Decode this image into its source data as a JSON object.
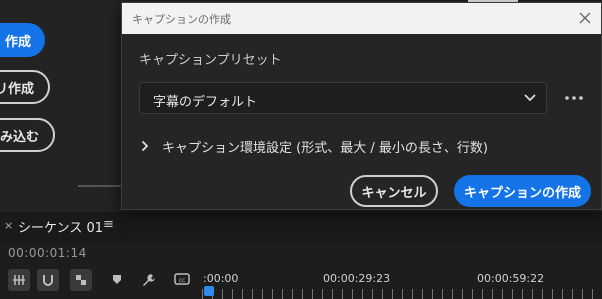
{
  "background": {
    "buttons": [
      {
        "label": "作成"
      },
      {
        "label": "リ作成"
      },
      {
        "label": "み込む"
      }
    ],
    "sequence": {
      "close_icon": "close-icon",
      "tab_title": "シーケンス 01",
      "menu_glyph": "≡",
      "timecode": "00:00:01:14"
    },
    "ruler": {
      "labels": [
        ":00:00",
        "00:00:29:23",
        "00:00:59:22"
      ]
    },
    "colors": {
      "accent": "#1473e6",
      "playhead": "#2d8ceb"
    }
  },
  "dialog": {
    "title": "キャプションの作成",
    "preset_section_label": "キャプションプリセット",
    "preset_selected": "字幕のデフォルト",
    "settings_disclosure": "キャプション環境設定 (形式、最大 / 最小の長さ、行数)",
    "cancel_label": "キャンセル",
    "create_label": "キャプションの作成"
  }
}
